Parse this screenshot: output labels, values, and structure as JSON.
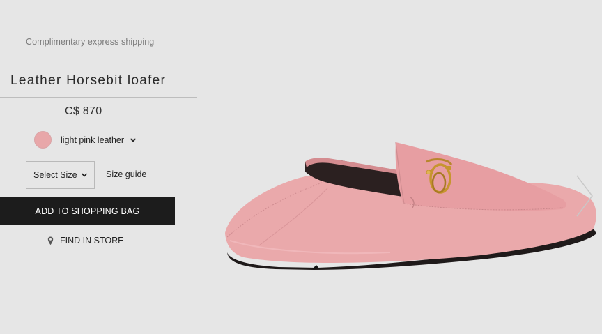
{
  "shipping_note": "Complimentary express shipping",
  "product": {
    "title": "Leather Horsebit loafer",
    "price": "C$ 870",
    "color_label": "light pink leather",
    "swatch_color": "#e8a7a9"
  },
  "size": {
    "select_label": "Select Size",
    "guide_label": "Size guide"
  },
  "actions": {
    "add_to_bag": "ADD TO SHOPPING BAG",
    "find_in_store": "FIND IN STORE"
  },
  "icons": {
    "color_dropdown": "chevron-down-icon",
    "size_dropdown": "chevron-down-icon",
    "store": "location-pin-icon",
    "carousel_next": "chevron-right-icon"
  }
}
